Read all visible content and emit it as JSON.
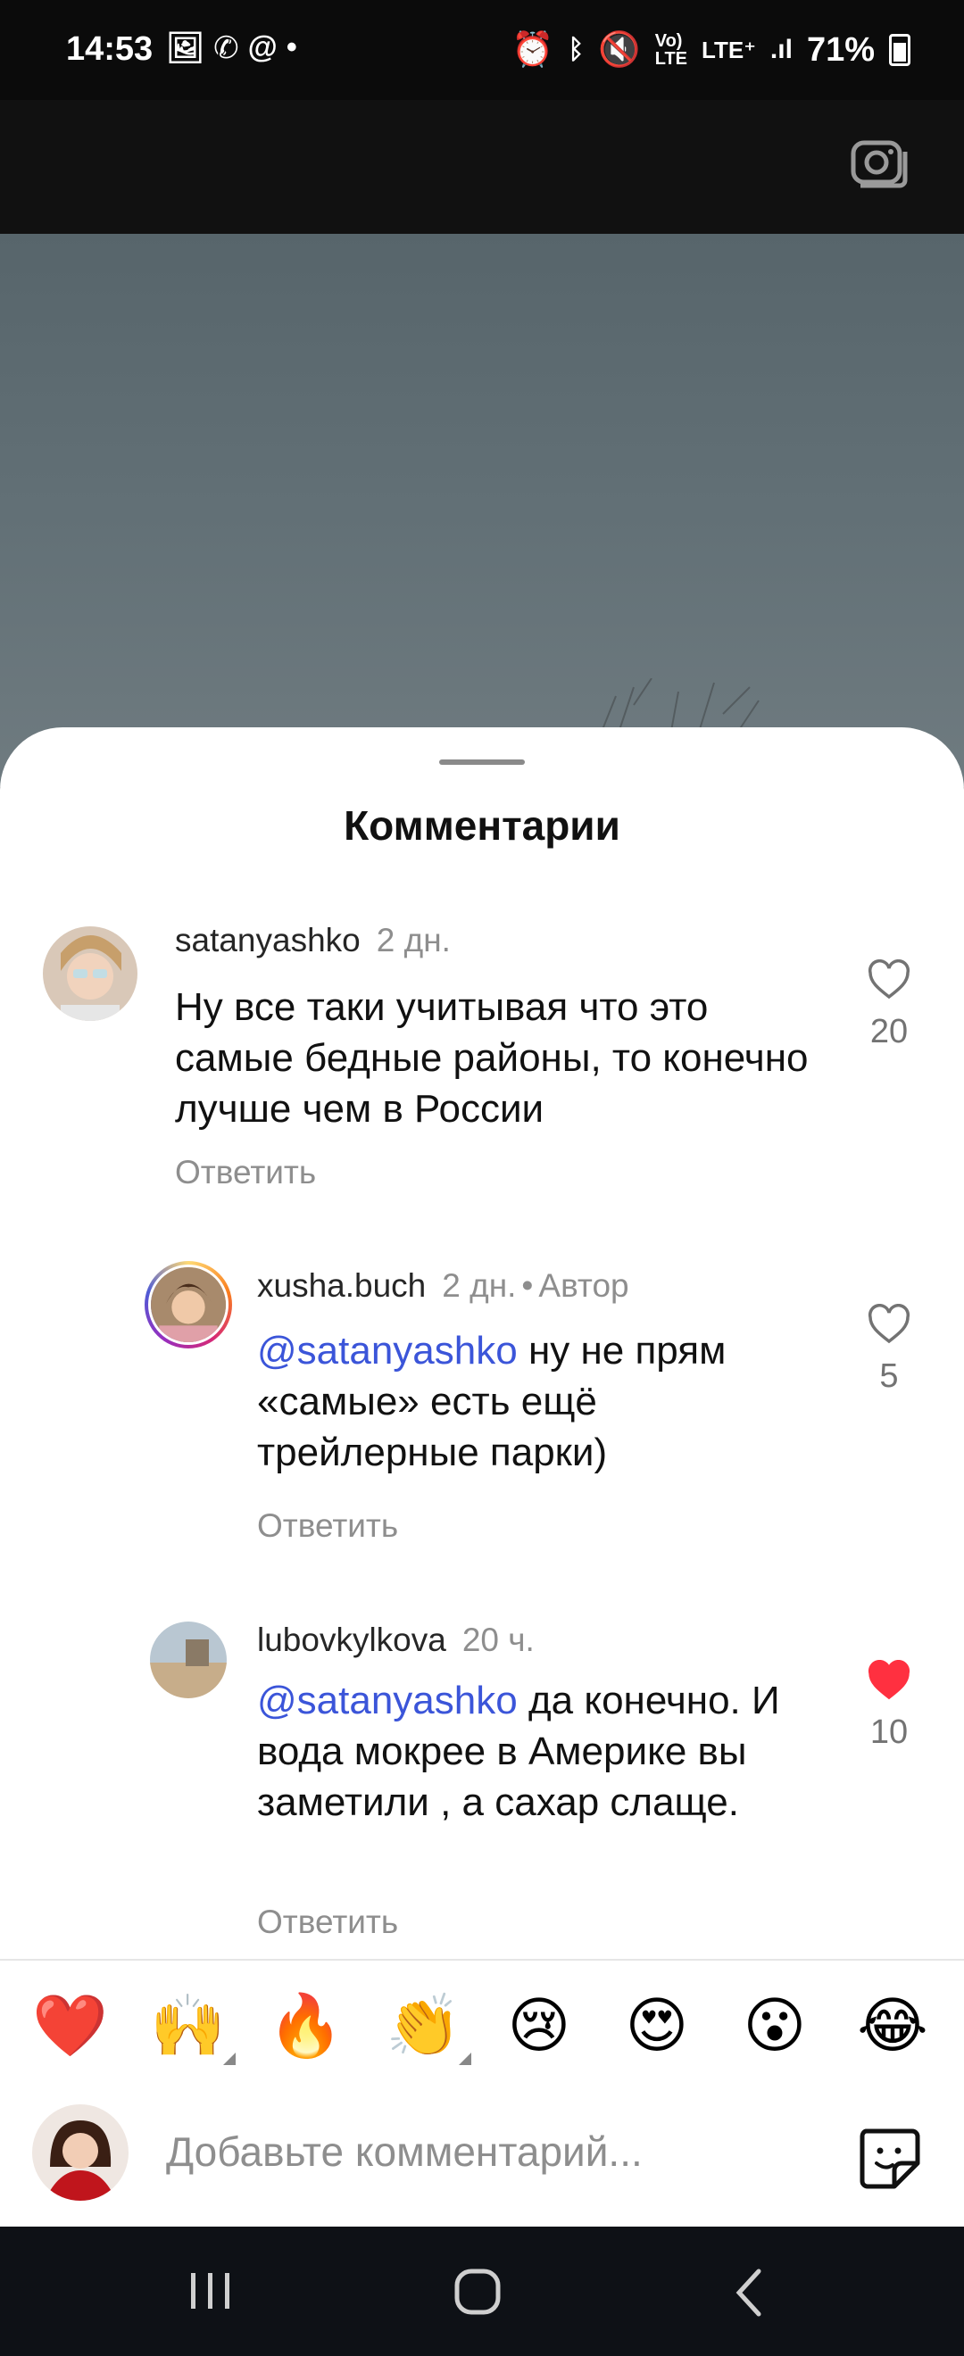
{
  "status_bar": {
    "time": "14:53",
    "left_icons": [
      "image-icon",
      "whatsapp-icon",
      "at-icon",
      "dot-icon"
    ],
    "right_icons": [
      "alarm-icon",
      "bluetooth-icon",
      "mute-icon",
      "volte-icon",
      "lte-icon",
      "signal-icon"
    ],
    "battery": "71%"
  },
  "sheet": {
    "title": "Комментарии"
  },
  "comments": [
    {
      "username": "satanyashko",
      "time": "2 дн.",
      "author_label": "",
      "mention": "",
      "text": "Ну все таки учитывая что это самые бедные районы, то конечно лучше чем в России",
      "reply_label": "Ответить",
      "likes": "20",
      "liked": false
    },
    {
      "username": "xusha.buch",
      "time": "2 дн.",
      "author_label": "Автор",
      "mention": "@satanyashko",
      "text": "ну не прям «самые» есть ещё трейлерные парки)",
      "reply_label": "Ответить",
      "likes": "5",
      "liked": false
    },
    {
      "username": "lubovkylkova",
      "time": "20 ч.",
      "author_label": "",
      "mention": "@satanyashko",
      "text": "да конечно. И вода мокрее в Америке вы заметили , а сахар слаще.",
      "reply_label": "Ответить",
      "likes": "10",
      "liked": true
    }
  ],
  "reactions": [
    "❤️",
    "🙌",
    "🔥",
    "👏",
    "😢",
    "😍",
    "😮",
    "😂"
  ],
  "composer": {
    "placeholder": "Добавьте комментарий..."
  },
  "colors": {
    "mention": "#3b55d9",
    "liked": "#ff3040",
    "muted_text": "#8e8e8e"
  }
}
